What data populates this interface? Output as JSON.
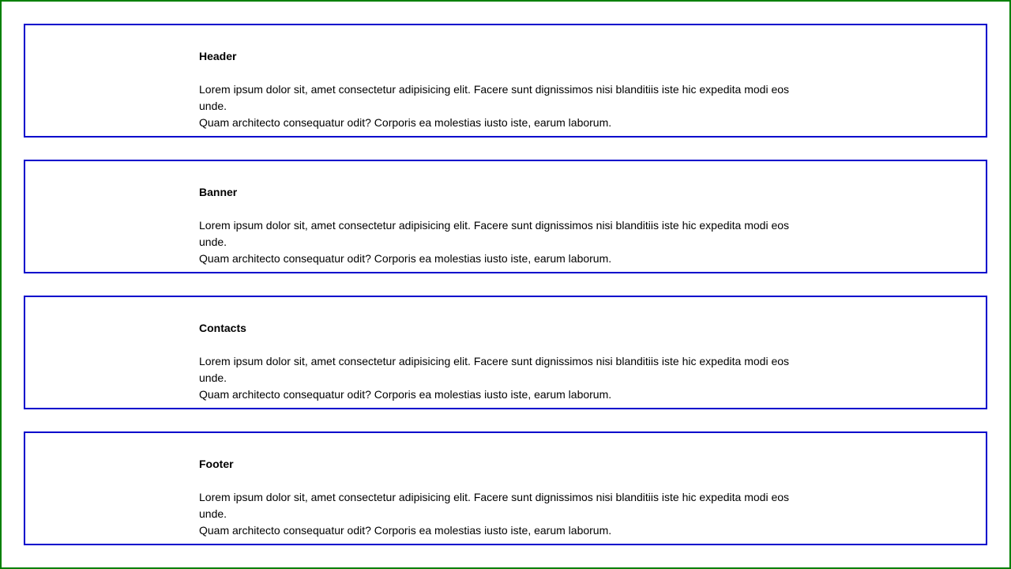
{
  "sections": [
    {
      "title": "Header",
      "text_line_1": "Lorem ipsum dolor sit, amet consectetur adipisicing elit. Facere sunt dignissimos nisi blanditiis iste hic expedita modi eos unde.",
      "text_line_2": "Quam architecto consequatur odit? Corporis ea molestias iusto iste, earum laborum."
    },
    {
      "title": "Banner",
      "text_line_1": "Lorem ipsum dolor sit, amet consectetur adipisicing elit. Facere sunt dignissimos nisi blanditiis iste hic expedita modi eos unde.",
      "text_line_2": "Quam architecto consequatur odit? Corporis ea molestias iusto iste, earum laborum."
    },
    {
      "title": "Contacts",
      "text_line_1": "Lorem ipsum dolor sit, amet consectetur adipisicing elit. Facere sunt dignissimos nisi blanditiis iste hic expedita modi eos unde.",
      "text_line_2": "Quam architecto consequatur odit? Corporis ea molestias iusto iste, earum laborum."
    },
    {
      "title": "Footer",
      "text_line_1": "Lorem ipsum dolor sit, amet consectetur adipisicing elit. Facere sunt dignissimos nisi blanditiis iste hic expedita modi eos unde.",
      "text_line_2": "Quam architecto consequatur odit? Corporis ea molestias iusto iste, earum laborum."
    }
  ],
  "colors": {
    "page_border": "#008000",
    "section_border": "#0000cc",
    "text": "#000000",
    "background": "#ffffff"
  }
}
